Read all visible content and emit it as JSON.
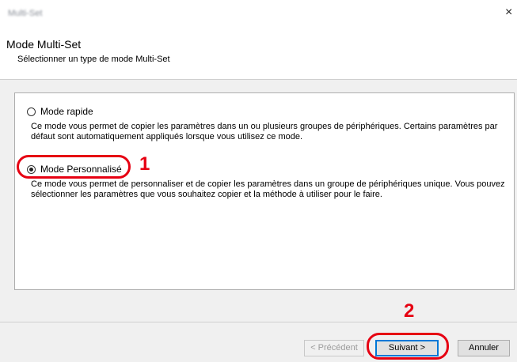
{
  "window": {
    "title": "Multi-Set",
    "close_glyph": "×",
    "close_icon": "close-icon"
  },
  "header": {
    "title": "Mode Multi-Set",
    "subtitle": "Sélectionner un type de mode Multi-Set"
  },
  "options": [
    {
      "label": "Mode rapide",
      "selected": false,
      "description": "Ce mode vous permet de copier les paramètres dans un ou plusieurs groupes de périphériques. Certains paramètres par défaut sont automatiquement appliqués lorsque vous utilisez ce mode."
    },
    {
      "label": "Mode Personnalisé",
      "selected": true,
      "description": "Ce mode vous permet de personnaliser et de copier les paramètres dans un groupe de périphériques unique. Vous pouvez sélectionner les paramètres que vous souhaitez copier et la méthode à utiliser pour le faire."
    }
  ],
  "buttons": {
    "previous": "< Précédent",
    "next": "Suivant >",
    "cancel": "Annuler"
  },
  "callouts": {
    "one": "1",
    "two": "2",
    "color": "#e60012"
  }
}
